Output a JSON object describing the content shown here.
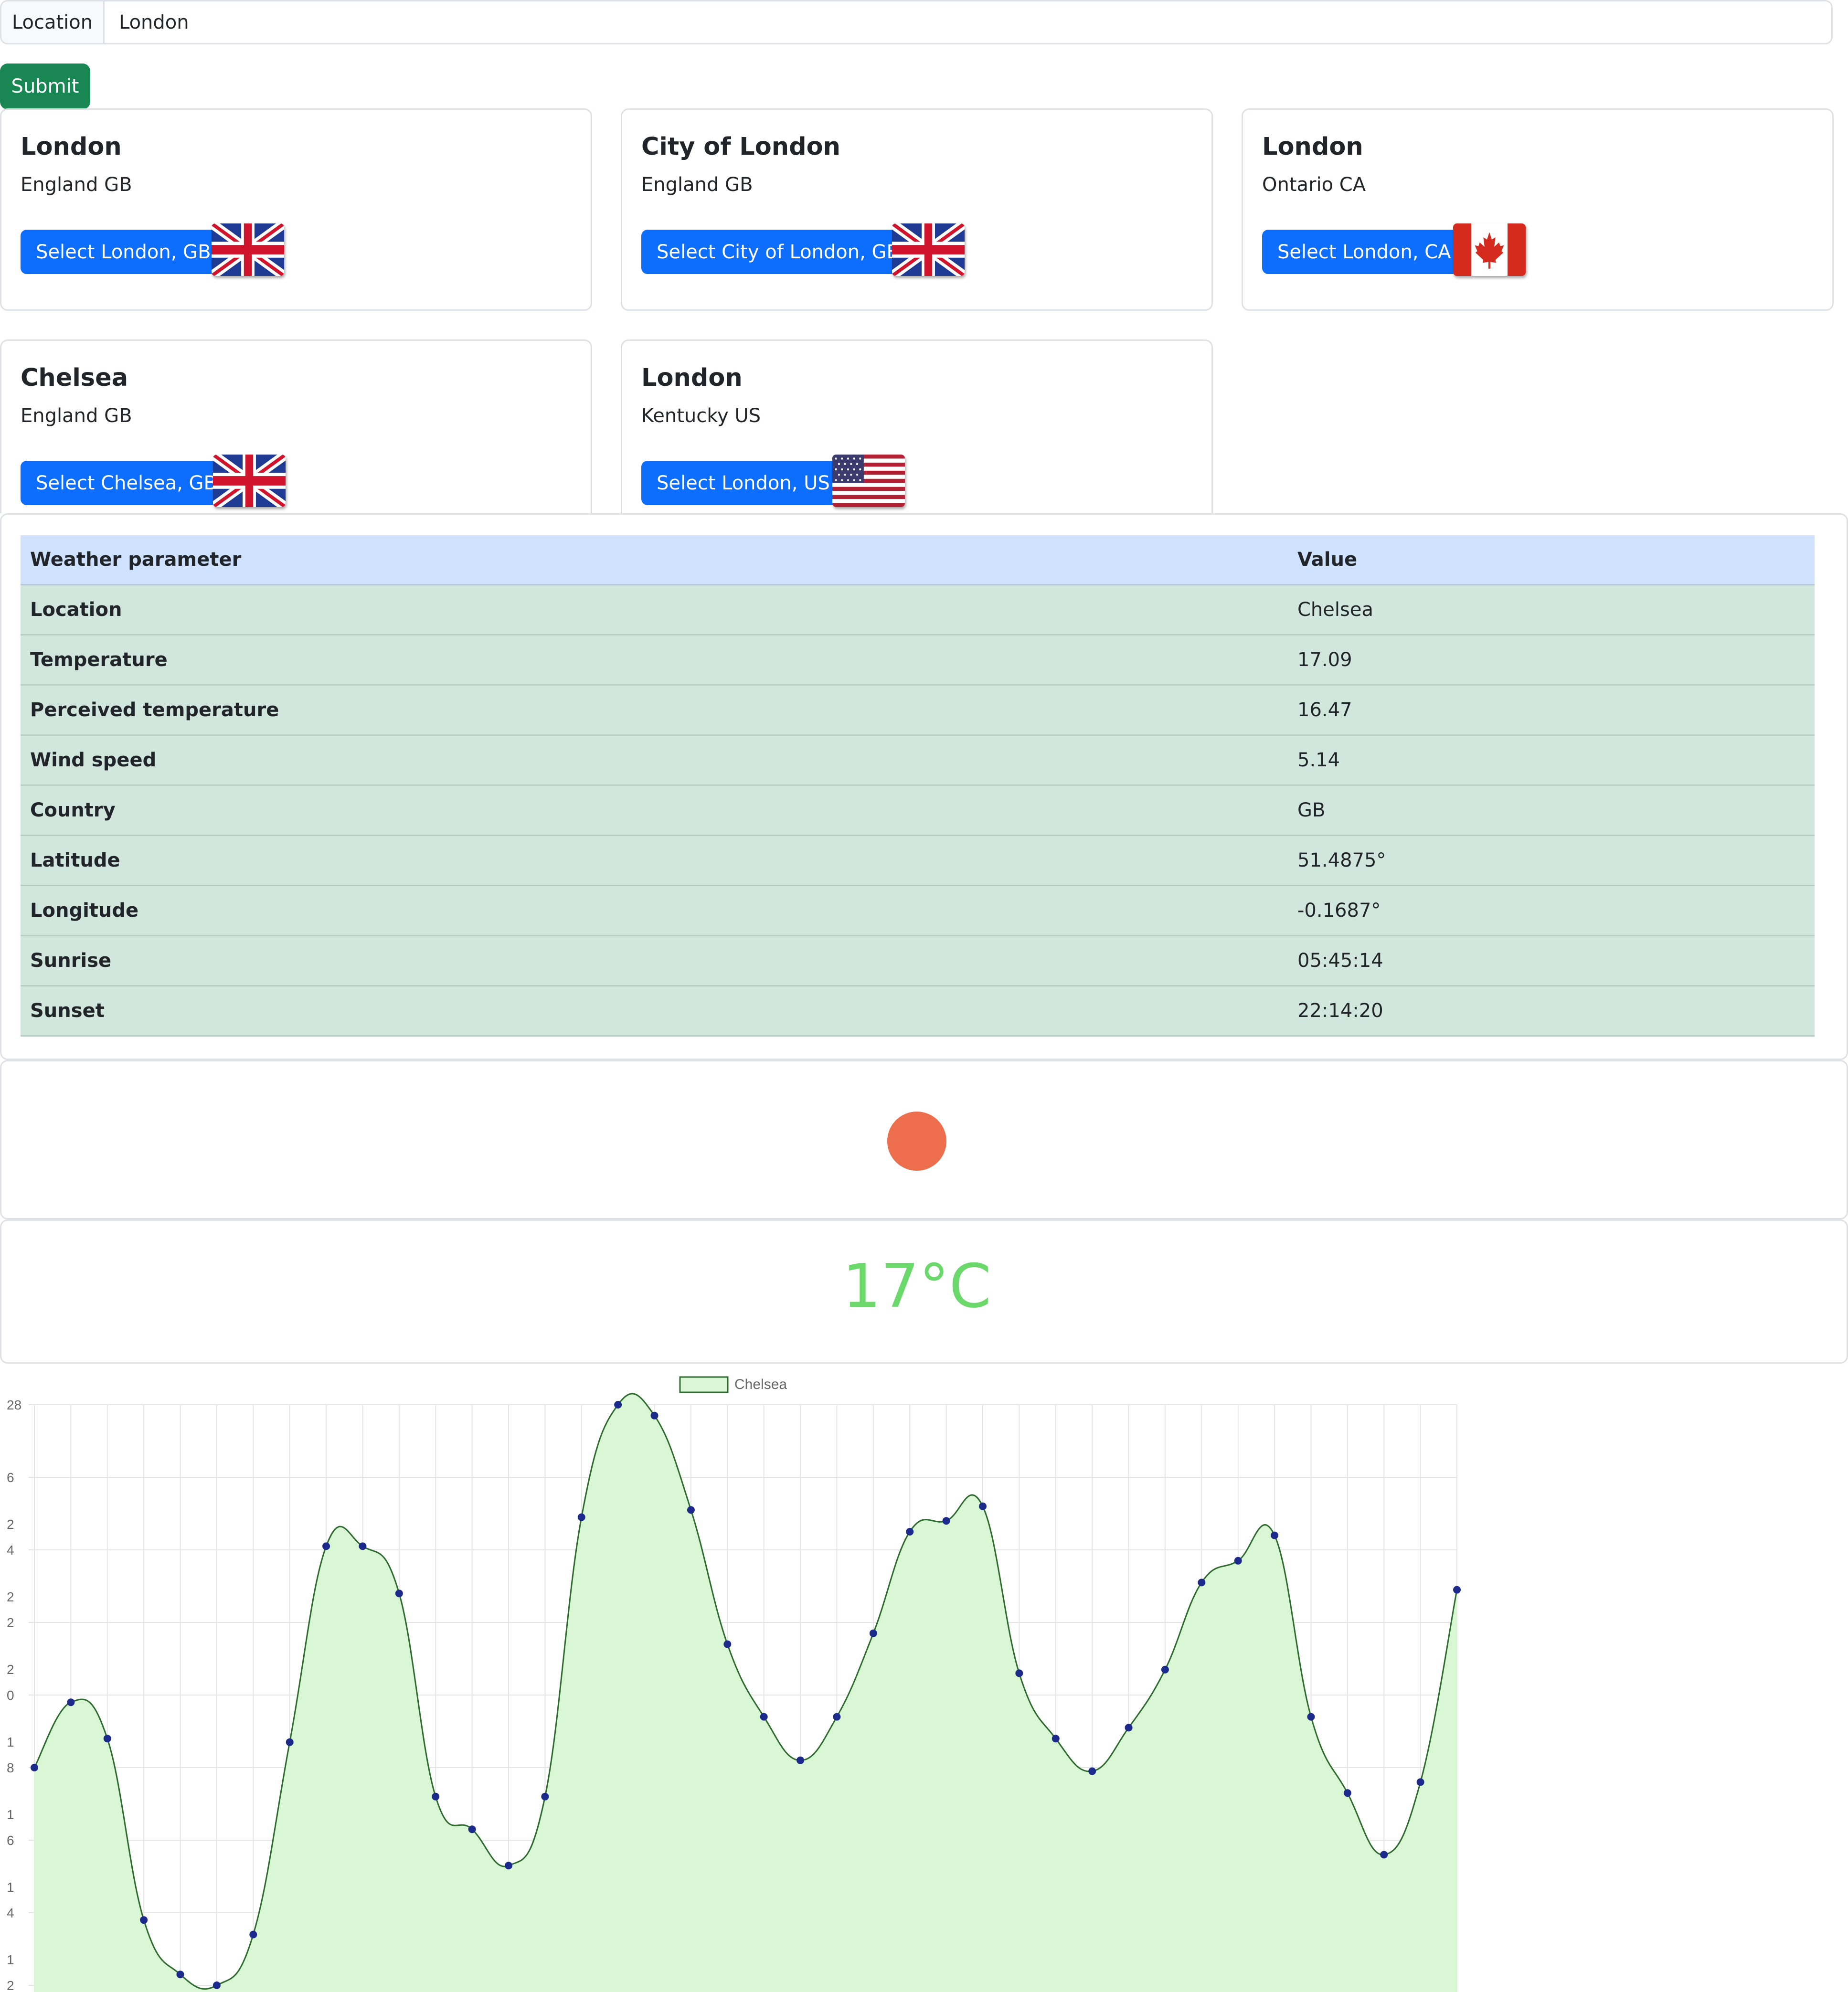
{
  "search": {
    "label": "Location",
    "value": "London",
    "submit_label": "Submit"
  },
  "cards": [
    {
      "name": "London",
      "region": "England GB",
      "button": "Select London, GB",
      "flag_icon": "uk-flag-icon"
    },
    {
      "name": "City of London",
      "region": "England GB",
      "button": "Select City of London, GB",
      "flag_icon": "uk-flag-icon"
    },
    {
      "name": "London",
      "region": "Ontario CA",
      "button": "Select London, CA",
      "flag_icon": "canada-flag-icon"
    },
    {
      "name": "Chelsea",
      "region": "England GB",
      "button": "Select Chelsea, GB",
      "flag_icon": "uk-flag-icon"
    },
    {
      "name": "London",
      "region": "Kentucky US",
      "button": "Select London, US",
      "flag_icon": "us-flag-icon"
    }
  ],
  "table": {
    "headers": [
      "Weather parameter",
      "Value"
    ],
    "rows": [
      [
        "Location",
        "Chelsea"
      ],
      [
        "Temperature",
        "17.09"
      ],
      [
        "Perceived temperature",
        "16.47"
      ],
      [
        "Wind speed",
        "5.14"
      ],
      [
        "Country",
        "GB"
      ],
      [
        "Latitude",
        "51.4875°"
      ],
      [
        "Longitude",
        "-0.1687°"
      ],
      [
        "Sunrise",
        "05:45:14"
      ],
      [
        "Sunset",
        "22:14:20"
      ]
    ]
  },
  "weather_icon": "sun-icon",
  "temperature_display": "17°C",
  "colors": {
    "submit": "#198754",
    "primary": "#0d6efd",
    "table_header": "#cfe2ff",
    "table_row": "#d1e7dd",
    "sun": "#ec6e4c",
    "temp_text": "#6ad86a",
    "chart_fill": "#d9f7d5",
    "chart_line": "#2e6b2e",
    "chart_point": "#1c2a8c"
  },
  "chart_data": {
    "type": "area",
    "series": [
      {
        "name": "Chelsea",
        "values": [
          18.0,
          19.8,
          18.8,
          13.8,
          12.3,
          12.0,
          13.4,
          18.7,
          24.1,
          24.1,
          22.8,
          17.2,
          16.3,
          15.3,
          17.2,
          24.9,
          28.0,
          27.7,
          25.1,
          21.4,
          19.4,
          18.2,
          19.4,
          21.7,
          24.5,
          24.8,
          25.2,
          20.6,
          18.8,
          17.9,
          19.1,
          20.7,
          23.1,
          23.7,
          24.4,
          19.4,
          17.3,
          15.6,
          17.6,
          22.9
        ]
      }
    ],
    "y_ticks": [
      "28",
      "6",
      "4",
      "2",
      "0",
      "8",
      "6",
      "4",
      "2"
    ],
    "y_tick_prefixes": [
      "",
      "2",
      "2",
      "2",
      "1",
      "1",
      "1",
      "1"
    ],
    "legend": "top",
    "grid": true
  }
}
